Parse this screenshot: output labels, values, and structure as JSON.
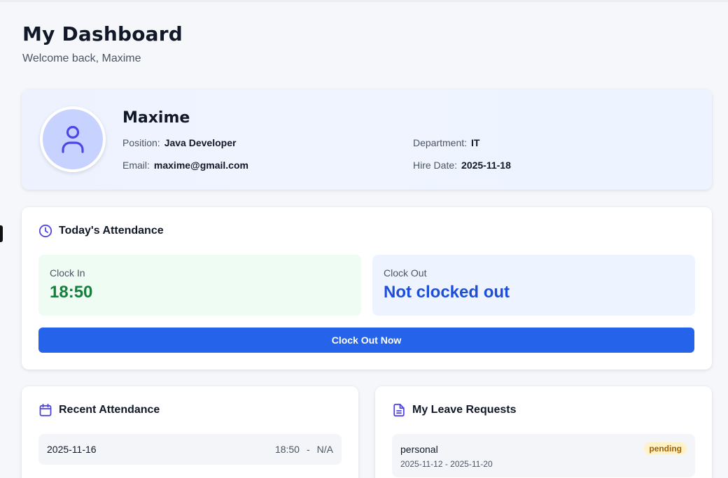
{
  "header": {
    "title": "My Dashboard",
    "subtitle": "Welcome back, Maxime"
  },
  "profile": {
    "name": "Maxime",
    "position_label": "Position:",
    "position": "Java Developer",
    "department_label": "Department:",
    "department": "IT",
    "email_label": "Email:",
    "email": "maxime@gmail.com",
    "hire_date_label": "Hire Date:",
    "hire_date": "2025-11-18",
    "avatar_icon": "user-icon"
  },
  "attendance": {
    "title": "Today's Attendance",
    "icon": "clock-icon",
    "clock_in_label": "Clock In",
    "clock_in_value": "18:50",
    "clock_out_label": "Clock Out",
    "clock_out_value": "Not clocked out",
    "button_label": "Clock Out Now"
  },
  "recent_attendance": {
    "title": "Recent Attendance",
    "icon": "calendar-icon",
    "rows": [
      {
        "date": "2025-11-16",
        "in": "18:50",
        "sep": "-",
        "out": "N/A"
      }
    ]
  },
  "leave_requests": {
    "title": "My Leave Requests",
    "icon": "document-icon",
    "rows": [
      {
        "type": "personal",
        "dates": "2025-11-12 - 2025-11-20",
        "status": "pending"
      }
    ]
  },
  "colors": {
    "accent": "#2563eb",
    "icon_purple": "#4f46e5",
    "clock_in_green": "#15803d",
    "clock_out_blue": "#1d4ed8",
    "pending_bg": "#fef3c7",
    "pending_text": "#a16207"
  }
}
